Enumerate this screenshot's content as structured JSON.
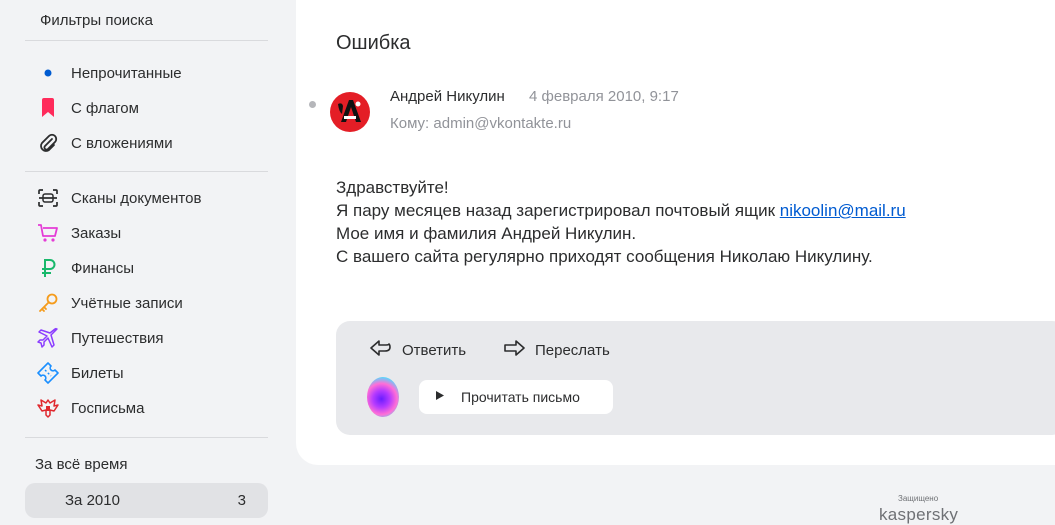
{
  "sidebar": {
    "heading": "Фильтры поиска",
    "filters": [
      {
        "label": "Непрочитанные",
        "icon": "unread-dot-icon"
      },
      {
        "label": "С флагом",
        "icon": "flag-icon"
      },
      {
        "label": "С вложениями",
        "icon": "paperclip-icon"
      }
    ],
    "categories": [
      {
        "label": "Сканы документов",
        "icon": "scan-icon"
      },
      {
        "label": "Заказы",
        "icon": "cart-icon"
      },
      {
        "label": "Финансы",
        "icon": "ruble-icon"
      },
      {
        "label": "Учётные записи",
        "icon": "key-icon"
      },
      {
        "label": "Путешествия",
        "icon": "plane-icon"
      },
      {
        "label": "Билеты",
        "icon": "ticket-icon"
      },
      {
        "label": "Госписьма",
        "icon": "emblem-icon"
      }
    ],
    "period_heading": "За всё время",
    "period_item": {
      "label": "За 2010",
      "count": "3"
    }
  },
  "letter": {
    "subject": "Ошибка",
    "sender_name": "Андрей Никулин",
    "date": "4 февраля 2010, 9:17",
    "to": "Кому: admin@vkontakte.ru",
    "body": {
      "line1": "Здравствуйте!",
      "line2_prefix": "Я пару месяцев назад зарегистрировал почтовый ящик ",
      "line2_link": "nikoolin@mail.ru",
      "line3": "Мое имя и фамилия Андрей Никулин.",
      "line4": "С вашего сайта регулярно приходят сообщения Николаю Никулину."
    }
  },
  "actions": {
    "reply": "Ответить",
    "forward": "Переслать",
    "read_aloud": "Прочитать письмо"
  },
  "footer": {
    "protected_label": "Защищено",
    "brand": "kaspersky"
  },
  "colors": {
    "accent_blue": "#005bd1",
    "flag_red": "#ff2b5b",
    "cart_pink": "#e43bd6",
    "ruble_green": "#18b86b",
    "key_orange": "#f59b1b",
    "plane_purple": "#8b3cff",
    "ticket_blue": "#1b8fff",
    "emblem_red": "#e0282e"
  }
}
